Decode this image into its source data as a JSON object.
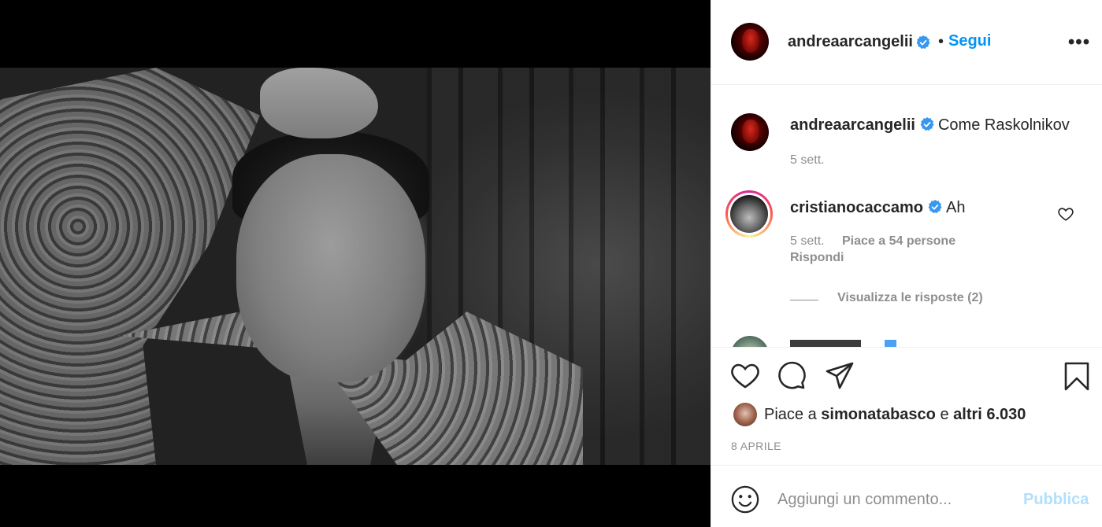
{
  "post": {
    "author": "andreaarcangelii",
    "follow_label": "Segui",
    "separator": "•",
    "more_label": "•••",
    "caption_text": "Come Raskolnikov",
    "caption_time": "5 sett.",
    "media_description": "black-and-white photo"
  },
  "comments": [
    {
      "user": "cristianocaccamo",
      "text": "Ah",
      "time": "5 sett.",
      "likes": "Piace a 54 persone",
      "reply_label": "Rispondi",
      "view_replies": "Visualizza le risposte (2)"
    }
  ],
  "likes": {
    "prefix": "Piace a",
    "user": "simonatabasco",
    "conjunction": "e",
    "others": "altri 6.030"
  },
  "date": "8 APRILE",
  "comment_box": {
    "placeholder": "Aggiungi un commento...",
    "publish_label": "Pubblica"
  },
  "colors": {
    "accent": "#0095f6",
    "publish_disabled": "#b2dffc",
    "muted": "#8e8e8e",
    "verified": "#3897f0"
  },
  "icons": [
    "verified-badge-icon",
    "heart-icon",
    "comment-icon",
    "share-icon",
    "bookmark-icon",
    "emoji-icon",
    "more-icon"
  ]
}
